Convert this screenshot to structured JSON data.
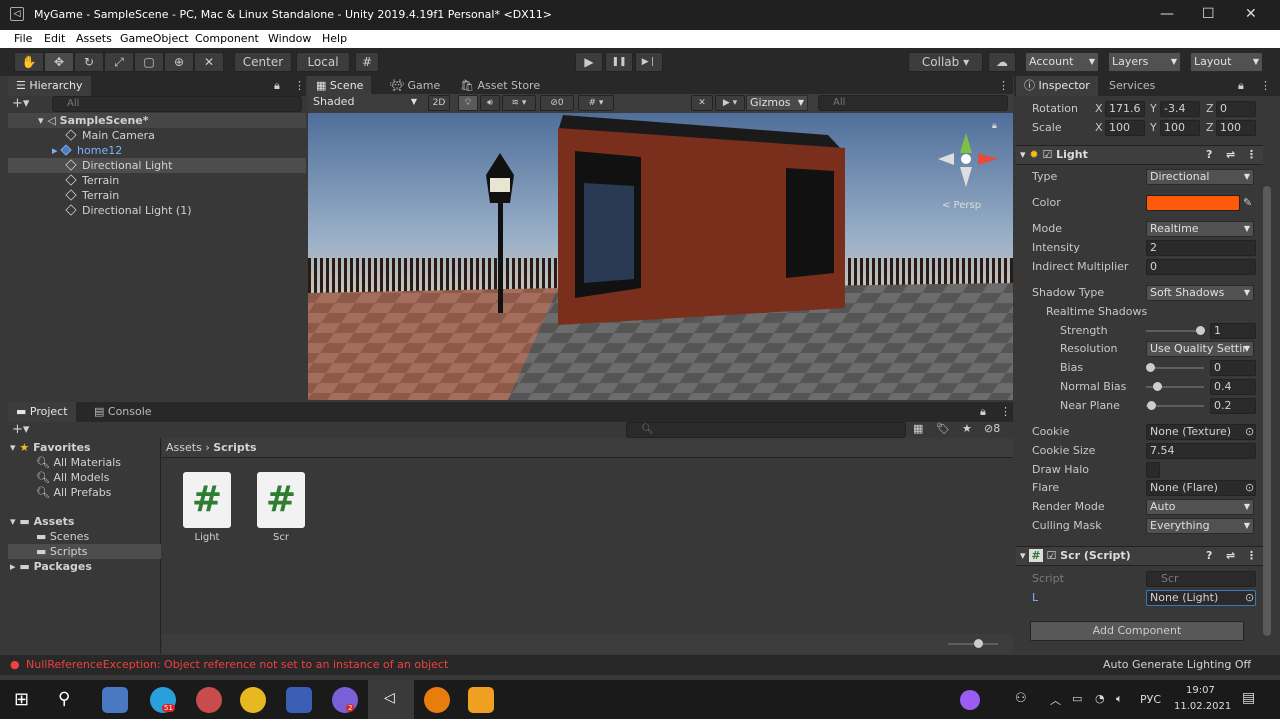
{
  "window": {
    "title": "MyGame - SampleScene - PC, Mac & Linux Standalone - Unity 2019.4.19f1 Personal* <DX11>",
    "min": "—",
    "max": "☐",
    "close": "✕"
  },
  "menu": [
    "File",
    "Edit",
    "Assets",
    "GameObject",
    "Component",
    "Window",
    "Help"
  ],
  "toolbar": {
    "center": "Center",
    "local": "Local",
    "collab": "Collab ▾",
    "account": "Account",
    "layers": "Layers",
    "layout": "Layout",
    "play": "▶",
    "pause": "❚❚",
    "step": "▶❘"
  },
  "hierarchy": {
    "tab": "Hierarchy",
    "search_placeholder": "All",
    "scene": "SampleScene*",
    "items": [
      "Main Camera",
      "home12",
      "Directional Light",
      "Terrain",
      "Terrain",
      "Directional Light (1)"
    ]
  },
  "scene": {
    "tabs": [
      "Scene",
      "Game",
      "Asset Store"
    ],
    "shading": "Shaded",
    "mode2d": "2D",
    "gizmos": "Gizmos",
    "search_placeholder": "All",
    "persp": "< Persp",
    "hidden_count": "0"
  },
  "project": {
    "tabs": [
      "Project",
      "Console"
    ],
    "favorites": "Favorites",
    "fav_items": [
      "All Materials",
      "All Models",
      "All Prefabs"
    ],
    "assets": "Assets",
    "asset_items": [
      "Scenes",
      "Scripts"
    ],
    "packages": "Packages",
    "breadcrumb_root": "Assets",
    "breadcrumb_sep": "›",
    "breadcrumb_leaf": "Scripts",
    "files": [
      "Light",
      "Scr"
    ],
    "hidden_count": "8"
  },
  "inspector": {
    "tabs": [
      "Inspector",
      "Services"
    ],
    "rotation": {
      "label": "Rotation",
      "x": "171.6",
      "y": "-3.4",
      "z": "0"
    },
    "scale": {
      "label": "Scale",
      "x": "100",
      "y": "100",
      "z": "100"
    },
    "light": {
      "title": "Light",
      "color_hex": "#ff5a0a",
      "rows": [
        [
          "Type",
          "Directional"
        ],
        [
          "Color",
          ""
        ],
        [
          "Mode",
          "Realtime"
        ],
        [
          "Intensity",
          "2"
        ],
        [
          "Indirect Multiplier",
          "0"
        ],
        [
          "Shadow Type",
          "Soft Shadows"
        ],
        [
          "Realtime Shadows",
          ""
        ],
        [
          "Strength",
          "1"
        ],
        [
          "Resolution",
          "Use Quality Settir"
        ],
        [
          "Bias",
          "0"
        ],
        [
          "Normal Bias",
          "0.4"
        ],
        [
          "Near Plane",
          "0.2"
        ],
        [
          "Cookie",
          "None (Texture)"
        ],
        [
          "Cookie Size",
          "7.54"
        ],
        [
          "Draw Halo",
          ""
        ],
        [
          "Flare",
          "None (Flare)"
        ],
        [
          "Render Mode",
          "Auto"
        ],
        [
          "Culling Mask",
          "Everything"
        ]
      ]
    },
    "script": {
      "title": "Scr (Script)",
      "script_label": "Script",
      "script_value": "Scr",
      "l_label": "L",
      "l_value": "None (Light)"
    },
    "add_component": "Add Component"
  },
  "status": {
    "error": "NullReferenceException: Object reference not set to an instance of an object",
    "right": "Auto Generate Lighting Off"
  },
  "taskbar": {
    "lang": "РУС",
    "time": "19:07",
    "date": "11.02.2021",
    "badge1": "51",
    "badge2": "2"
  }
}
